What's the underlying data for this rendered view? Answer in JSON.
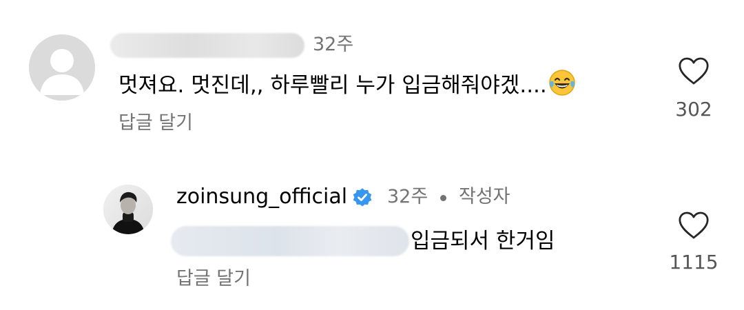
{
  "comments": [
    {
      "avatar": "default-profile-icon",
      "username_blurred": true,
      "time": "32주",
      "text": "멋져요. 멋진데,, 하루빨리 누가 입금해줘야겠....",
      "emoji": "face-with-tears-of-joy",
      "reply_label": "답글 달기",
      "likes": "302"
    },
    {
      "avatar": "user-photo",
      "username": "zoinsung_official",
      "verified": true,
      "time": "32주",
      "author_label": "작성자",
      "mention_blurred": true,
      "text": "입금되서 한거임",
      "reply_label": "답글 달기",
      "likes": "1115"
    }
  ],
  "colors": {
    "secondary_text": "#737373",
    "verified_blue": "#3797f0",
    "heart_stroke": "#262626"
  }
}
